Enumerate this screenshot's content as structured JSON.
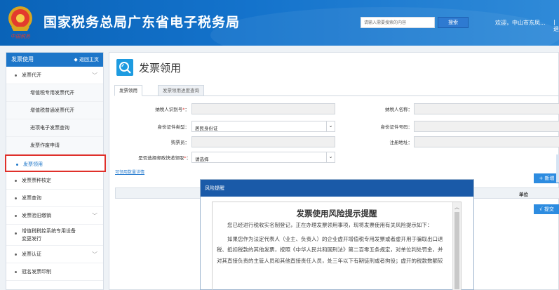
{
  "header": {
    "title": "国家税务总局广东省电子税务局",
    "search_placeholder": "请输入需要搜索的内容",
    "search_label": "搜索",
    "welcome": "欢迎，中山市东凤...",
    "logout_partial": "| 退",
    "emblem_caption": "中国税务"
  },
  "sidebar": {
    "header_label": "发票使用",
    "back_label": "◆ 返回主页",
    "items": [
      {
        "label": "发票代开",
        "level": "top",
        "chevron": "﹀"
      },
      {
        "label": "增值税专用发票代开",
        "level": "sub"
      },
      {
        "label": "增值税普通发票代开",
        "level": "sub"
      },
      {
        "label": "进项电子发票查询",
        "level": "sub"
      },
      {
        "label": "发票作废申请",
        "level": "sub"
      },
      {
        "label": "发票领用",
        "level": "top",
        "active": true
      },
      {
        "label": "发票票种核定",
        "level": "top"
      },
      {
        "label": "发票查询",
        "level": "top"
      },
      {
        "label": "发票验旧缴销",
        "level": "top",
        "chevron": "﹀"
      },
      {
        "label": "增值税税控系统专用设备",
        "label2": "变更发行",
        "level": "top"
      },
      {
        "label": "发票认证",
        "level": "top",
        "chevron": "﹀"
      },
      {
        "label": "冠名发票印制",
        "level": "top"
      }
    ]
  },
  "main": {
    "title": "发票领用",
    "tabs": [
      "发票领用",
      "发票领用进度查询"
    ],
    "form": {
      "taxpayer_id_label": "纳税人识别号",
      "taxpayer_name_label": "纳税人名称：",
      "id_type_label": "身份证件类型：",
      "id_type_value": "居民身份证",
      "id_number_label": "身份证件号码：",
      "buyer_label": "购票员：",
      "address_label": "注册地址：",
      "delivery_label": "是否选择邮政快递领取",
      "delivery_value": "请选择",
      "colon": "："
    },
    "detail_link": "可领用数量详情",
    "add_label": "+ 新增",
    "unit_header": "单位",
    "submit_label": "√ 提交"
  },
  "modal": {
    "header": "风险提醒",
    "title": "发票使用风险提示提醒",
    "paragraph1": "您已经进行税收实名制登记，正在办理发票领用事项，现将发票使用有关风险提示如下：",
    "paragraph2": "如果您作为法定代表人（业主、负责人）的企业虚开增值税专用发票或者虚开用于骗取出口退税、抵扣税款的其他发票，按照《中华人民共和国刑法》第二百零五条规定，对单位判处罚金，并对其直接负责的主管人员和其他直接责任人员，处三年以下有期徒刑或者拘役；虚开的税款数额较"
  },
  "colors": {
    "header_blue": "#0a63b8",
    "sidebar_blue": "#1d76c9",
    "active_border": "#e0302a",
    "modal_head": "#1a5aa8",
    "button_blue": "#2d8ce0"
  }
}
